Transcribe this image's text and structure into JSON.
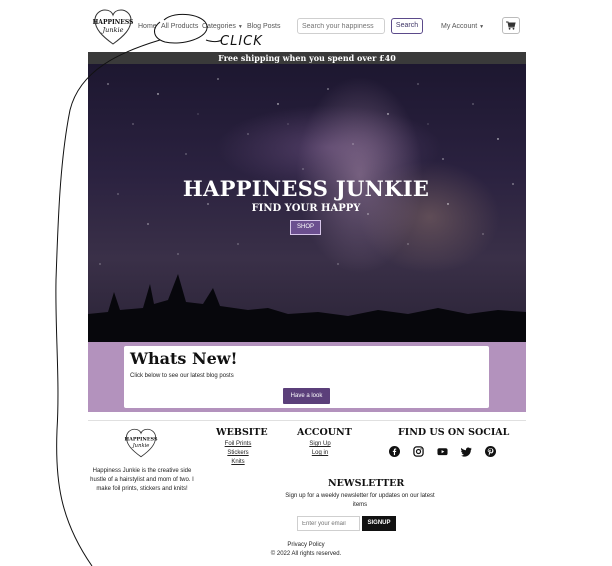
{
  "brand": {
    "logo_alt": "Happiness Junkie"
  },
  "nav": {
    "home": "Home",
    "all_products": "All Products",
    "categories": "Categories",
    "blog_posts": "Blog Posts",
    "my_account": "My Account",
    "search_placeholder": "Search your happiness",
    "search_button": "Search"
  },
  "annotation": {
    "text": "CLICK"
  },
  "banner": {
    "text": "Free shipping when you spend over £40"
  },
  "hero": {
    "title": "HAPPINESS JUNKIE",
    "subtitle": "FIND YOUR HAPPY",
    "button": "SHOP"
  },
  "whats_new": {
    "title": "Whats New!",
    "text": "Click below to see our latest blog posts",
    "button": "Have a look"
  },
  "footer": {
    "about": "Happiness Junkie is the creative side hustle of a hairstylist and mom of two. I make foil prints, stickers and knits!",
    "website": {
      "heading": "WEBSITE",
      "links": [
        "Foil Prints",
        "Stickers",
        "Knits"
      ]
    },
    "account": {
      "heading": "ACCOUNT",
      "links": [
        "Sign Up",
        "Log in"
      ]
    },
    "social": {
      "heading": "FIND US ON SOCIAL",
      "icons": [
        "facebook-icon",
        "instagram-icon",
        "youtube-icon",
        "twitter-icon",
        "pinterest-icon"
      ]
    },
    "newsletter": {
      "heading": "NEWSLETTER",
      "text": "Sign up for a weekly newsletter for updates on our latest items",
      "email_placeholder": "Enter your email",
      "button": "SIGNUP"
    },
    "privacy": "Privacy Policy",
    "copyright": "© 2022 All rights reserved."
  },
  "colors": {
    "banner": "#3a3a3a",
    "accent": "#6b4f8f",
    "band": "#b392bd"
  }
}
